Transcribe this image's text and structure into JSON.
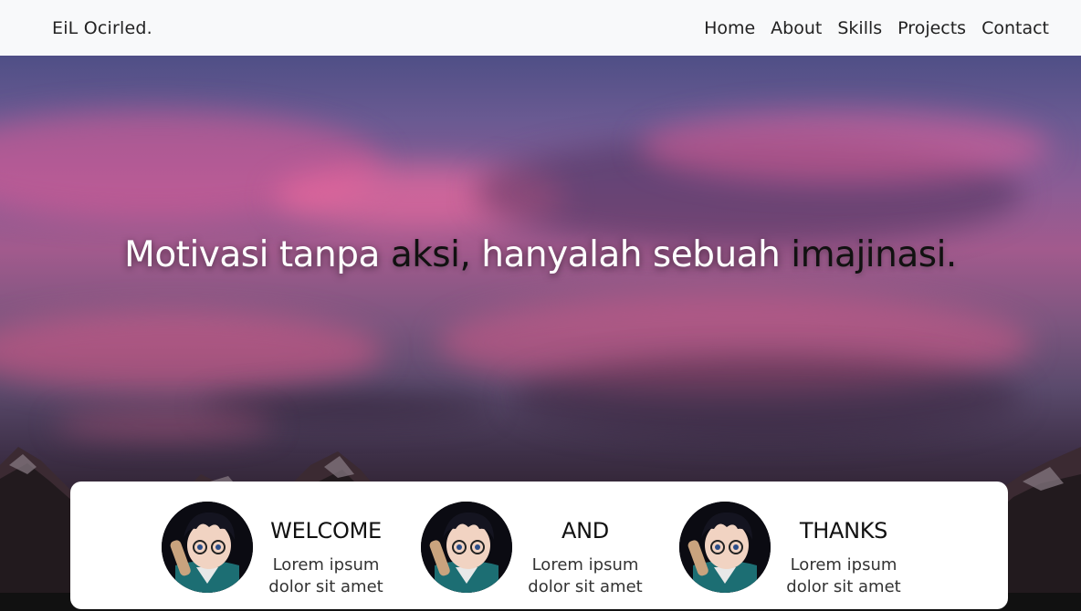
{
  "navbar": {
    "brand": "EiL Ocirled.",
    "links": [
      "Home",
      "About",
      "Skills",
      "Projects",
      "Contact"
    ]
  },
  "hero": {
    "quote": {
      "part1": "Motivasi tanpa ",
      "part2": "aksi,",
      "part3": " hanyalah sebuah ",
      "part4": "imajinasi."
    }
  },
  "features": [
    {
      "title": "WELCOME",
      "text": "Lorem ipsum dolor sit amet"
    },
    {
      "title": "AND",
      "text": "Lorem ipsum dolor sit amet"
    },
    {
      "title": "THANKS",
      "text": "Lorem ipsum dolor sit amet"
    }
  ],
  "colors": {
    "navbar_bg": "#f8f9fa",
    "card_bg": "#ffffff",
    "quote_light": "#ffffff",
    "quote_dark": "#111111"
  },
  "icons": {
    "avatar": "anime-character-avatar"
  }
}
